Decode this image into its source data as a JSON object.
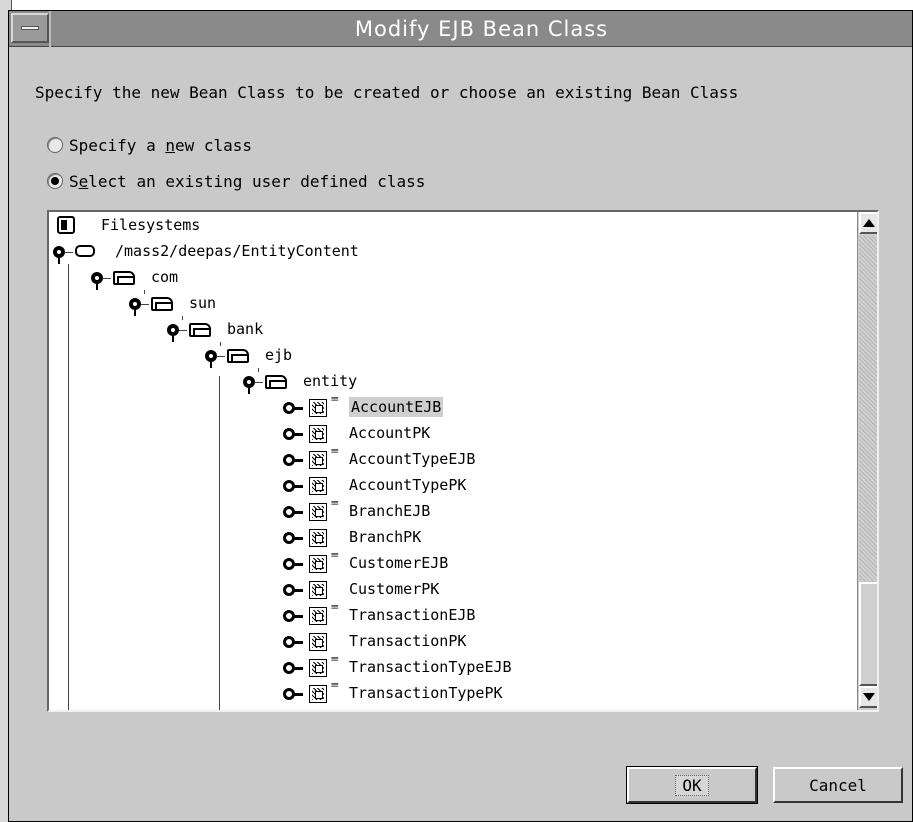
{
  "window": {
    "title": "Modify EJB Bean Class"
  },
  "instruction": "Specify the new Bean Class to be created or choose an existing Bean Class",
  "options": [
    {
      "label_pre": "Specify a ",
      "mnemonic": "n",
      "label_post": "ew class",
      "selected": false
    },
    {
      "label_pre": "S",
      "mnemonic": "e",
      "label_post": "lect an existing user defined class",
      "selected": true
    }
  ],
  "tree": {
    "root": "Filesystems",
    "mount": "/mass2/deepas/EntityContent",
    "packages": [
      "com",
      "sun",
      "bank",
      "ejb",
      "entity"
    ],
    "classes": [
      {
        "name": "AccountEJB",
        "ejb": true,
        "selected": true
      },
      {
        "name": "AccountPK",
        "ejb": false
      },
      {
        "name": "AccountTypeEJB",
        "ejb": true
      },
      {
        "name": "AccountTypePK",
        "ejb": false
      },
      {
        "name": "BranchEJB",
        "ejb": true
      },
      {
        "name": "BranchPK",
        "ejb": false
      },
      {
        "name": "CustomerEJB",
        "ejb": true
      },
      {
        "name": "CustomerPK",
        "ejb": false
      },
      {
        "name": "TransactionEJB",
        "ejb": true
      },
      {
        "name": "TransactionPK",
        "ejb": false
      },
      {
        "name": "TransactionTypeEJB",
        "ejb": true
      },
      {
        "name": "TransactionTypePK",
        "ejb": true
      }
    ],
    "ejb_marker": "≡≡"
  },
  "buttons": {
    "ok": "OK",
    "cancel": "Cancel"
  },
  "colors": {
    "window_bg": "#c9c9c9",
    "titlebar": "#8a8a8a",
    "selection": "#cfcfcf"
  }
}
